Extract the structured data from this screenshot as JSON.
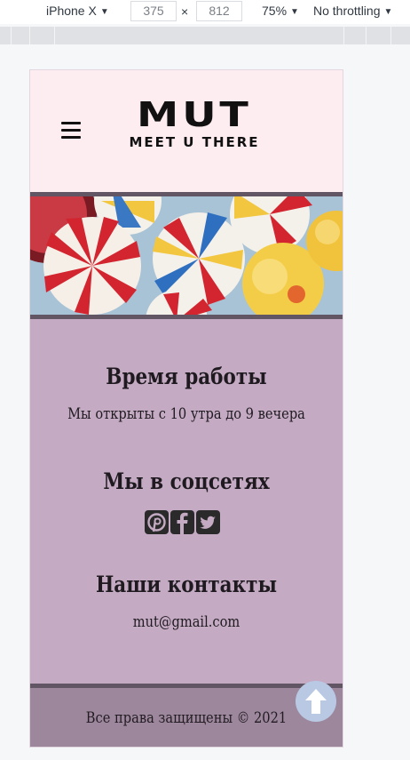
{
  "devtools": {
    "device": "iPhone X",
    "width": "375",
    "times": "×",
    "height": "812",
    "zoom": "75%",
    "throttling": "No throttling"
  },
  "header": {
    "logo_main": "MUT",
    "logo_sub": "MEET U THERE"
  },
  "sections": {
    "hours_title": "Время работы",
    "hours_text": "Мы открыты с 10 утра до 9 вечера",
    "social_title": "Мы в соцсетях",
    "contacts_title": "Наши контакты",
    "contacts_email": "mut@gmail.com"
  },
  "social_icons": [
    "pinterest-icon",
    "facebook-icon",
    "twitter-icon"
  ],
  "footer": {
    "copyright": "Все права защищены © 2021"
  },
  "colors": {
    "header_bg": "#fdedf1",
    "content_bg": "#c4abc3",
    "footer_bg": "#9d879c",
    "separator": "#625664",
    "to_top_button": "#b9c9e4"
  }
}
